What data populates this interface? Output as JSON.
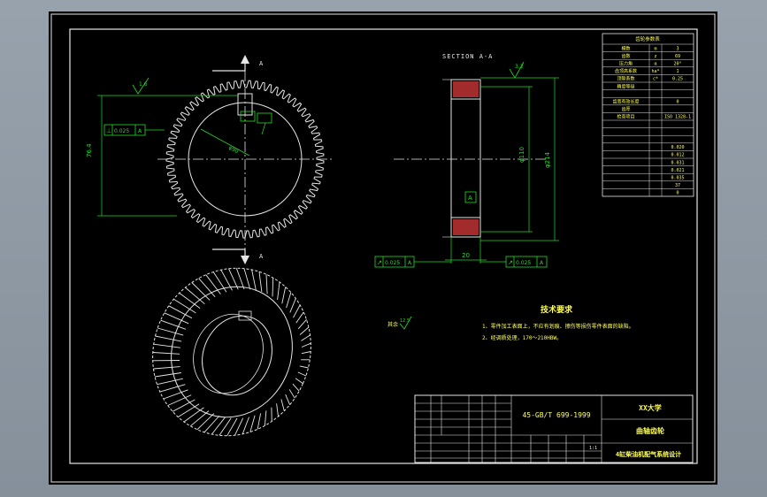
{
  "drawing": {
    "section_label": "SECTION A-A",
    "cut_label_top": "A",
    "cut_label_bottom": "A",
    "roughness_1": "1.6",
    "roughness_2": "3.2",
    "roughness_3": "12.5",
    "roughness_other_label": "其余",
    "tol_1": "0.025",
    "tol_datum_1": "A",
    "tol_2": "0.025",
    "tol_datum_2": "A",
    "tol_3": "0.025",
    "tol_datum_3": "A",
    "dim_keyway": "76.4",
    "dim_bore": "φ90",
    "dim_width": "20",
    "dim_d1": "φ110",
    "dim_d2": "φ214",
    "datum_label": "A"
  },
  "tech_req": {
    "title": "技术要求",
    "items": [
      "1、零件加工表面上，不应有划痕、擦伤等损伤零件表面的缺陷。",
      "2、经调质处理，170～210HBW。"
    ]
  },
  "param_table": {
    "title": "齿轮参数表",
    "rows": [
      [
        "模数",
        "m",
        "3"
      ],
      [
        "齿数",
        "z",
        "69"
      ],
      [
        "压力角",
        "α",
        "20°"
      ],
      [
        "齿顶高系数",
        "ha*",
        "1"
      ],
      [
        "顶隙系数",
        "c*",
        "0.25"
      ],
      [
        "精度等级",
        "",
        ""
      ],
      [
        "",
        "",
        ""
      ],
      [
        "齿宽有效长度",
        "",
        "0"
      ],
      [
        "齿厚",
        "",
        ""
      ],
      [
        "检查项目",
        "",
        "ISO 1328-1"
      ],
      [
        "",
        "",
        ""
      ],
      [
        "",
        "",
        ""
      ],
      [
        "",
        "",
        ""
      ],
      [
        "",
        "",
        "0.020"
      ],
      [
        "",
        "",
        "0.012"
      ],
      [
        "",
        "",
        "0.031"
      ],
      [
        "",
        "",
        "0.021"
      ],
      [
        "",
        "",
        "0.035"
      ],
      [
        "",
        "",
        "37"
      ],
      [
        "",
        "",
        "0"
      ]
    ]
  },
  "title_block": {
    "material": "45-GB/T 699-1999",
    "school": "XX大学",
    "part_name": "曲轴齿轮",
    "project": "4缸柴油机配气系统设计",
    "scale": "1:1"
  }
}
